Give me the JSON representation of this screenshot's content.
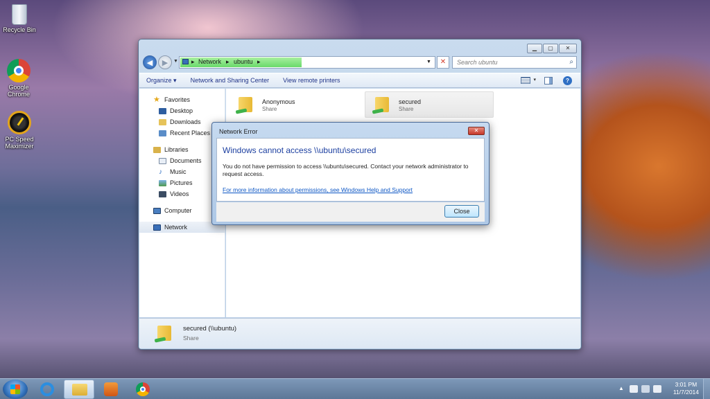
{
  "desktop": {
    "icons": [
      {
        "label": "Recycle Bin",
        "icon": "recycle-bin-icon"
      },
      {
        "label": "Google Chrome",
        "icon": "chrome-icon"
      },
      {
        "label": "PC Speed Maximizer",
        "icon": "speedometer-icon"
      }
    ]
  },
  "explorer": {
    "address": {
      "crumbs": [
        "Network",
        "ubuntu"
      ]
    },
    "search_placeholder": "Search ubuntu",
    "toolbar": {
      "organize": "Organize",
      "network_sharing": "Network and Sharing Center",
      "remote_printers": "View remote printers"
    },
    "nav": {
      "favorites": "Favorites",
      "desktop": "Desktop",
      "downloads": "Downloads",
      "recent": "Recent Places",
      "libraries": "Libraries",
      "documents": "Documents",
      "music": "Music",
      "pictures": "Pictures",
      "videos": "Videos",
      "computer": "Computer",
      "network": "Network"
    },
    "items": [
      {
        "name": "Anonymous",
        "type": "Share"
      },
      {
        "name": "secured",
        "type": "Share"
      }
    ],
    "details": {
      "name": "secured (\\\\ubuntu)",
      "type": "Share"
    }
  },
  "dialog": {
    "title": "Network Error",
    "heading": "Windows cannot access \\\\ubuntu\\secured",
    "message": "You do not have permission to access \\\\ubuntu\\secured. Contact your network administrator to request access.",
    "link": "For more information about permissions, see Windows Help and Support",
    "close_button": "Close"
  },
  "taskbar": {
    "apps": [
      "internet-explorer-icon",
      "windows-explorer-icon",
      "media-player-icon",
      "chrome-icon"
    ],
    "time": "3:01 PM",
    "date": "11/7/2014"
  }
}
